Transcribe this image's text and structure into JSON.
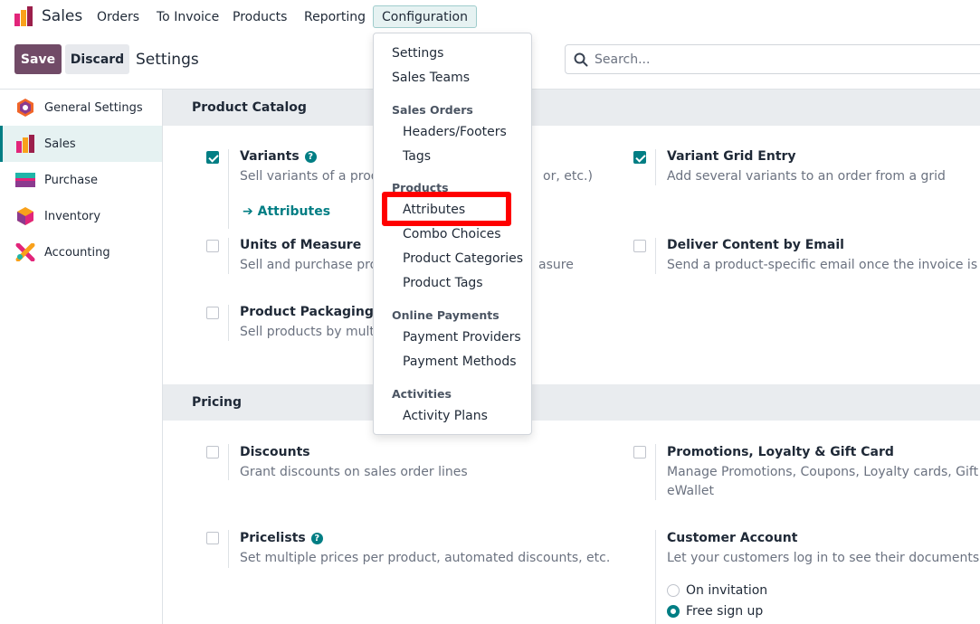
{
  "topnav": {
    "app_name": "Sales",
    "menu": [
      "Orders",
      "To Invoice",
      "Products",
      "Reporting",
      "Configuration"
    ]
  },
  "control": {
    "save_label": "Save",
    "discard_label": "Discard",
    "title": "Settings",
    "search_placeholder": "Search..."
  },
  "sidebar": {
    "items": [
      {
        "label": "General Settings",
        "icon": "general-settings-icon"
      },
      {
        "label": "Sales",
        "icon": "sales-icon"
      },
      {
        "label": "Purchase",
        "icon": "purchase-icon"
      },
      {
        "label": "Inventory",
        "icon": "inventory-icon"
      },
      {
        "label": "Accounting",
        "icon": "accounting-icon"
      }
    ],
    "active": "Sales"
  },
  "sections": {
    "catalog": {
      "title": "Product Catalog",
      "variants": {
        "title": "Variants",
        "desc": "Sell variants of a produc",
        "desc_tail": "or, etc.)",
        "checked": true,
        "link": "Attributes"
      },
      "variant_grid": {
        "title": "Variant Grid Entry",
        "desc": "Add several variants to an order from a grid",
        "checked": true
      },
      "uom": {
        "title": "Units of Measure",
        "desc": "Sell and purchase produ",
        "desc_tail": "asure",
        "checked": false
      },
      "deliver_email": {
        "title": "Deliver Content by Email",
        "desc": "Send a product-specific email once the invoice is validat",
        "checked": false
      },
      "packagings": {
        "title": "Product Packagings",
        "desc": "Sell products by multipl",
        "checked": false
      }
    },
    "pricing": {
      "title": "Pricing",
      "discounts": {
        "title": "Discounts",
        "desc": "Grant discounts on sales order lines",
        "checked": false
      },
      "promotions": {
        "title": "Promotions, Loyalty & Gift Card",
        "desc": "Manage Promotions, Coupons, Loyalty cards, Gift cards",
        "desc2": "eWallet",
        "checked": false
      },
      "pricelists": {
        "title": "Pricelists",
        "desc": "Set multiple prices per product, automated discounts, etc.",
        "checked": false
      },
      "customer_account": {
        "title": "Customer Account",
        "desc": "Let your customers log in to see their documents",
        "options": [
          "On invitation",
          "Free sign up"
        ],
        "selected": "Free sign up"
      }
    }
  },
  "dropdown": {
    "items_top": [
      "Settings",
      "Sales Teams"
    ],
    "sales_orders_head": "Sales Orders",
    "sales_orders": [
      "Headers/Footers",
      "Tags"
    ],
    "products_head": "Products",
    "products": [
      "Attributes",
      "Combo Choices",
      "Product Categories",
      "Product Tags"
    ],
    "online_payments_head": "Online Payments",
    "online_payments": [
      "Payment Providers",
      "Payment Methods"
    ],
    "activities_head": "Activities",
    "activities": [
      "Activity Plans"
    ],
    "highlighted": "Attributes",
    "highlight_color": "#ff0000"
  },
  "colors": {
    "primary": "#714b67",
    "accent": "#017e84"
  }
}
